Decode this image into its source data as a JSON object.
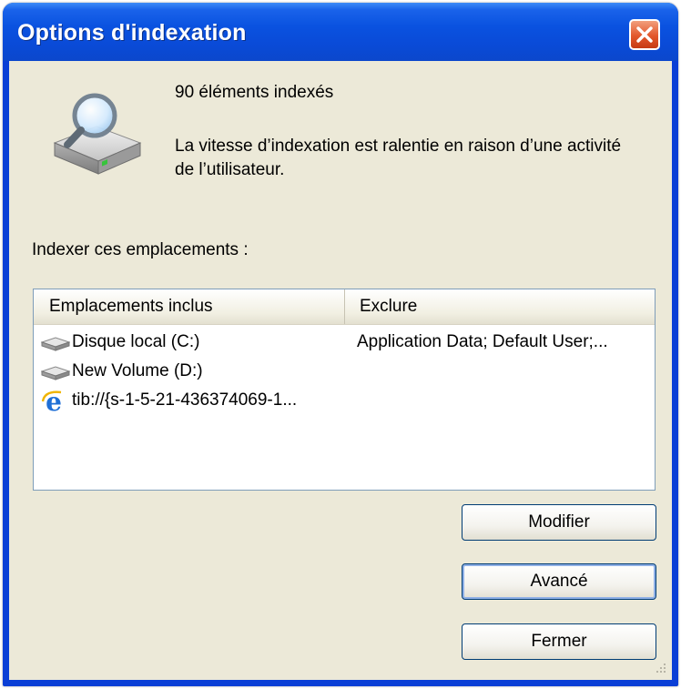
{
  "window": {
    "title": "Options d'indexation",
    "close_icon": "close-icon"
  },
  "status": {
    "items_indexed": "90 éléments indexés",
    "speed_message": "La vitesse d’indexation est ralentie en raison d’une activité de l’utilisateur."
  },
  "locations": {
    "label": "Indexer ces emplacements :",
    "columns": [
      "Emplacements inclus",
      "Exclure"
    ],
    "rows": [
      {
        "icon": "drive-icon",
        "name": "Disque local (C:)",
        "exclude": "Application Data; Default User;..."
      },
      {
        "icon": "drive-icon",
        "name": "New Volume (D:)",
        "exclude": ""
      },
      {
        "icon": "internet-explorer-icon",
        "name": "tib://{s-1-5-21-436374069-1...",
        "exclude": ""
      }
    ]
  },
  "buttons": {
    "modify": "Modifier",
    "advanced": "Avancé",
    "close": "Fermer"
  },
  "colors": {
    "titlebar": "#0a4bd8",
    "dialog_bg": "#ece9d8",
    "close_button": "#e2572b"
  }
}
